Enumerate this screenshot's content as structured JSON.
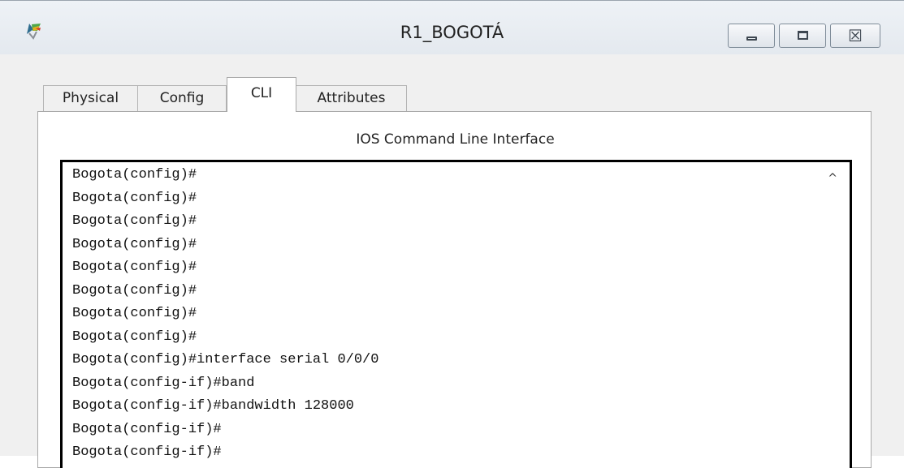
{
  "window": {
    "title": "R1_BOGOTÁ",
    "icon": "packet-tracer-router-icon",
    "controls": [
      "minimize",
      "maximize",
      "close"
    ],
    "close_glyph": "☒"
  },
  "tabs": [
    {
      "label": "Physical",
      "active": false
    },
    {
      "label": "Config",
      "active": false
    },
    {
      "label": "CLI",
      "active": true
    },
    {
      "label": "Attributes",
      "active": false
    }
  ],
  "cli": {
    "heading": "IOS Command Line Interface",
    "scroll_glyph": "^",
    "lines": [
      "Bogota(config)#",
      "Bogota(config)#",
      "Bogota(config)#",
      "Bogota(config)#",
      "Bogota(config)#",
      "Bogota(config)#",
      "Bogota(config)#",
      "Bogota(config)#",
      "Bogota(config)#interface serial 0/0/0",
      "Bogota(config-if)#band",
      "Bogota(config-if)#bandwidth 128000",
      "Bogota(config-if)#",
      "Bogota(config-if)#"
    ]
  }
}
